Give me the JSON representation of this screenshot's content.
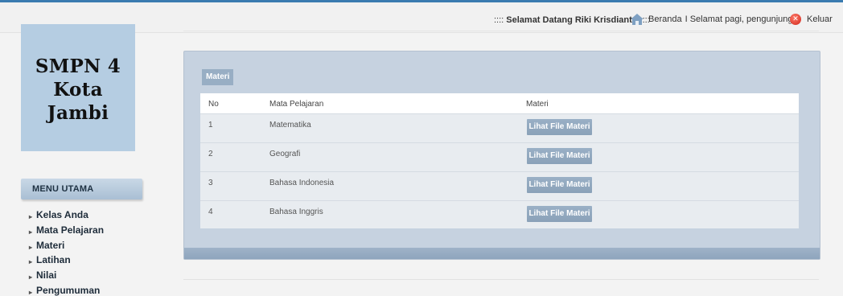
{
  "topbar": {
    "welcome_prefix": ":::: ",
    "welcome_main": "Selamat Datang Riki Krisdianto",
    "welcome_suffix": " ::::",
    "home_label": "Beranda",
    "greeting": " I Selamat pagi, pengunjung...",
    "logout_label": "Keluar"
  },
  "logo": {
    "line1": "SMPN 4",
    "line2": "Kota Jambi"
  },
  "menu": {
    "header": "MENU UTAMA",
    "items": [
      {
        "label": "Kelas Anda"
      },
      {
        "label": "Mata Pelajaran"
      },
      {
        "label": "Materi"
      },
      {
        "label": "Latihan"
      },
      {
        "label": "Nilai"
      },
      {
        "label": "Pengumuman"
      }
    ]
  },
  "panel": {
    "tag": "Materi",
    "columns": {
      "no": "No",
      "mapel": "Mata Pelajaran",
      "materi": "Materi"
    },
    "rows": [
      {
        "no": "1",
        "mapel": "Matematika",
        "button": "Lihat File Materi"
      },
      {
        "no": "2",
        "mapel": "Geografi",
        "button": "Lihat File Materi"
      },
      {
        "no": "3",
        "mapel": "Bahasa Indonesia",
        "button": "Lihat File Materi"
      },
      {
        "no": "4",
        "mapel": "Bahasa Inggris",
        "button": "Lihat File Materi"
      }
    ]
  },
  "colors": {
    "accent_blue": "#3a7bb0",
    "logo_bg": "#b5cde2",
    "panel_bg": "#c6d2e0",
    "button_bg": "#98aec4",
    "logout_red": "#d0261a"
  },
  "icons": {
    "home": "home-icon",
    "logout": "close-circle-icon",
    "menu_bullet": "triangle-right-icon"
  }
}
